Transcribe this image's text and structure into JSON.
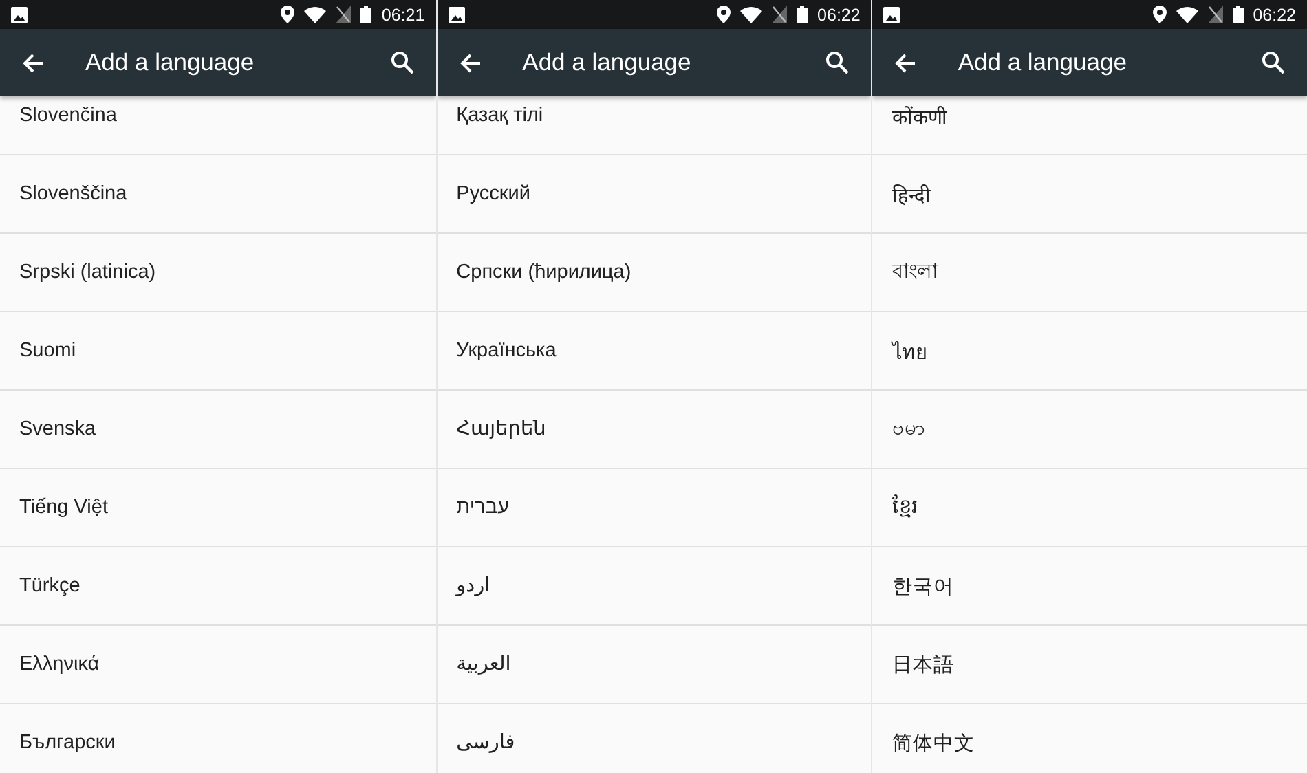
{
  "screens": [
    {
      "status_bar": {
        "time": "06:21"
      },
      "toolbar": {
        "title": "Add a language"
      },
      "languages": [
        "Slovenčina",
        "Slovenščina",
        "Srpski (latinica)",
        "Suomi",
        "Svenska",
        "Tiếng Việt",
        "Türkçe",
        "Ελληνικά",
        "Български"
      ]
    },
    {
      "status_bar": {
        "time": "06:22"
      },
      "toolbar": {
        "title": "Add a language"
      },
      "languages": [
        "Қазақ тілі",
        "Русский",
        "Српски (ћирилица)",
        "Українська",
        "Հայերեն",
        "עברית",
        "اردو",
        "العربية",
        "فارسی"
      ]
    },
    {
      "status_bar": {
        "time": "06:22"
      },
      "toolbar": {
        "title": "Add a language"
      },
      "languages": [
        "कोंकणी",
        "हिन्दी",
        "বাংলা",
        "ไทย",
        "ဗမာ",
        "ខ្មែរ",
        "한국어",
        "日本語",
        "简体中文"
      ]
    }
  ]
}
